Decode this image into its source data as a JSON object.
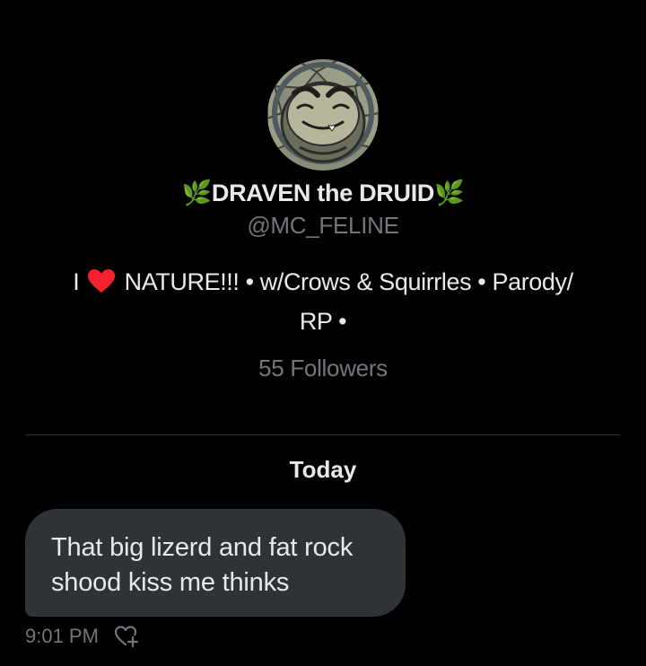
{
  "profile": {
    "display_name": "🌿DRAVEN the DRUID🌿",
    "handle": "@MC_FELINE",
    "bio_prefix": "I",
    "bio_heart_icon": "red-heart-icon",
    "bio_line1": "NATURE!!! • w/Crows & Squirrles • Parody/",
    "bio_line2": "RP •",
    "followers": "55 Followers"
  },
  "conversation": {
    "day_label": "Today",
    "messages": [
      {
        "text_line1": "That big lizerd and fat rock",
        "text_line2": "shood kiss me thinks",
        "time": "9:01 PM",
        "reaction_icon": "add-reaction-heart-icon"
      }
    ]
  },
  "colors": {
    "background": "#000000",
    "primary_text": "#e7e9ea",
    "secondary_text": "#71767b",
    "bubble": "#2f3336",
    "divider": "#2f3336",
    "heart": "#f4212e"
  }
}
